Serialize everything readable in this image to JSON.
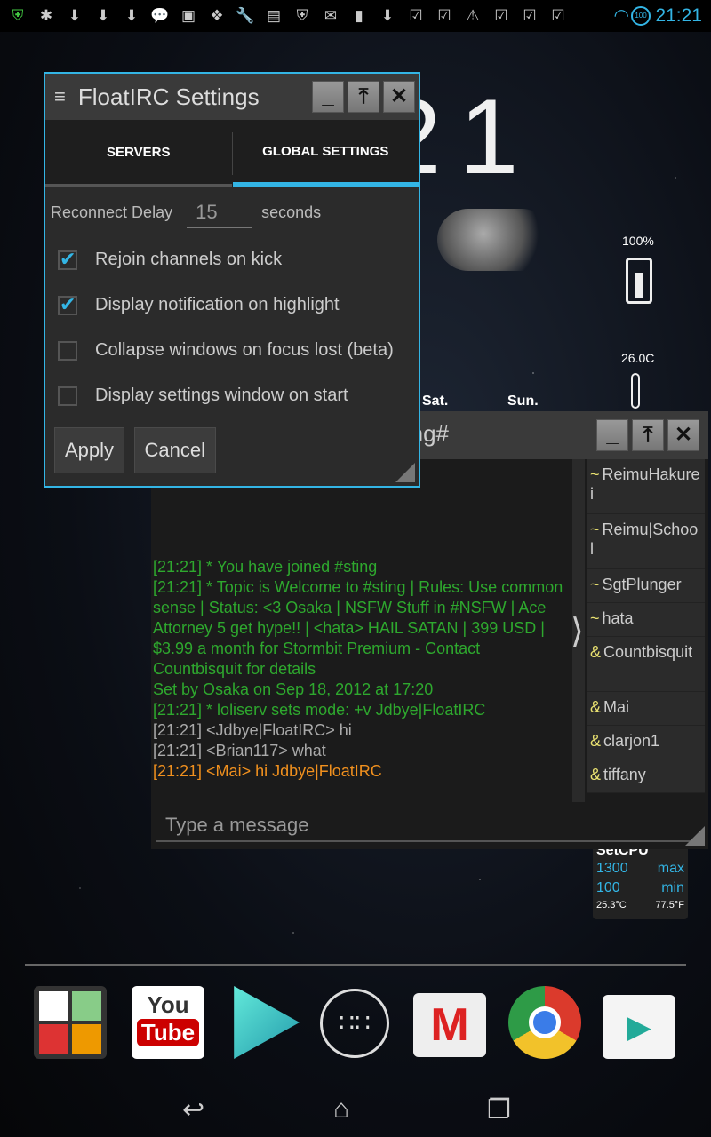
{
  "status_bar": {
    "time": "21:21",
    "battery_badge": "100",
    "icons": [
      "shield-icon",
      "settings-icon",
      "download-icon",
      "download-icon",
      "download-icon",
      "chat-icon",
      "image-icon",
      "dropbox-icon",
      "wrench-icon",
      "irc-icon",
      "shield-icon",
      "gmail-icon",
      "notes-icon",
      "download-icon",
      "check-icon",
      "check-icon",
      "warning-icon",
      "check-icon",
      "check-icon",
      "check-icon"
    ]
  },
  "widgets": {
    "clock": "21",
    "battery_pct": "100%",
    "temp": "26.0C",
    "days": [
      "Sat.",
      "Sun."
    ],
    "setcpu": {
      "title": "SetCPU",
      "max_val": "1300",
      "max_label": "max",
      "min_val": "100",
      "min_label": "min",
      "temp_c": "25.3°C",
      "temp_f": "77.5°F"
    }
  },
  "settings": {
    "title": "FloatIRC Settings",
    "tabs": [
      "SERVERS",
      "GLOBAL SETTINGS"
    ],
    "active_tab": 1,
    "reconnect_label": "Reconnect Delay",
    "reconnect_value": "15",
    "reconnect_unit": "seconds",
    "options": [
      {
        "label": "Rejoin channels on kick",
        "checked": true
      },
      {
        "label": "Display notification on highlight",
        "checked": true
      },
      {
        "label": "Collapse windows on focus lost (beta)",
        "checked": false
      },
      {
        "label": "Display settings window on start",
        "checked": false
      }
    ],
    "apply": "Apply",
    "cancel": "Cancel"
  },
  "chat": {
    "title": "#sting",
    "messages": [
      {
        "text": "[21:21] * You have joined #sting",
        "color": "#2ea82e"
      },
      {
        "text": "[21:21] * Topic is Welcome to #sting | Rules: Use common sense | Status: <3 Osaka | NSFW Stuff in #NSFW | Ace Attorney 5 get hype!! | <hata> HAIL SATAN | 399 USD | $3.99 a month for Stormbit Premium - Contact Countbisquit for details",
        "color": "#2ea82e"
      },
      {
        "text": "Set by Osaka on Sep 18, 2012 at 17:20",
        "color": "#2ea82e"
      },
      {
        "text": "[21:21] * loliserv sets mode: +v Jdbye|FloatIRC",
        "color": "#2ea82e"
      },
      {
        "text": "[21:21] <Jdbye|FloatIRC> hi",
        "color": "#aaaaaa"
      },
      {
        "text": "[21:21] <Brian117> what",
        "color": "#aaaaaa"
      },
      {
        "text": "[21:21] <Mai> hi Jdbye|FloatIRC",
        "color": "#f0901e"
      }
    ],
    "nicks": [
      {
        "p": "~",
        "n": "ReimuHakurei"
      },
      {
        "p": "~",
        "n": "Reimu|School"
      },
      {
        "p": "~",
        "n": "SgtPlunger"
      },
      {
        "p": "~",
        "n": "hata"
      },
      {
        "p": "&",
        "n": "Countbisquit"
      },
      {
        "p": "&",
        "n": "Mai"
      },
      {
        "p": "&",
        "n": "clarjon1"
      },
      {
        "p": "&",
        "n": "tiffany"
      }
    ],
    "input_placeholder": "Type a message"
  },
  "dock": {
    "apps": [
      "google-apps-folder",
      "YouTube",
      "video-player",
      "app-drawer",
      "Gmail",
      "Chrome",
      "Play Store"
    ],
    "youtube_top": "You",
    "youtube_bottom": "Tube"
  },
  "accent": "#33b5e5"
}
